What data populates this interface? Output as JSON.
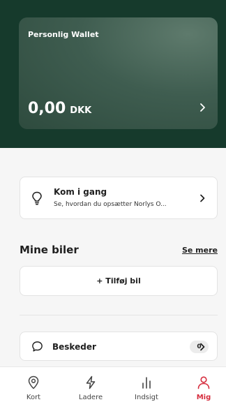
{
  "wallet": {
    "title": "Personlig Wallet",
    "amount": "0,00",
    "currency": "DKK"
  },
  "getting_started": {
    "title": "Kom i gang",
    "subtitle": "Se, hvordan du opsætter Norlys O..."
  },
  "cars": {
    "title": "Mine biler",
    "see_more": "Se mere",
    "add_label": "+ Tilføj bil"
  },
  "messages": {
    "label": "Beskeder",
    "count": "0"
  },
  "tabs": [
    {
      "label": "Kort",
      "icon": "map-pin-icon",
      "active": false
    },
    {
      "label": "Ladere",
      "icon": "lightning-icon",
      "active": false
    },
    {
      "label": "Indsigt",
      "icon": "bar-chart-icon",
      "active": false
    },
    {
      "label": "Mig",
      "icon": "person-icon",
      "active": true
    }
  ],
  "colors": {
    "header_bg": "#163a2c",
    "active_tab": "#d62d3e"
  }
}
